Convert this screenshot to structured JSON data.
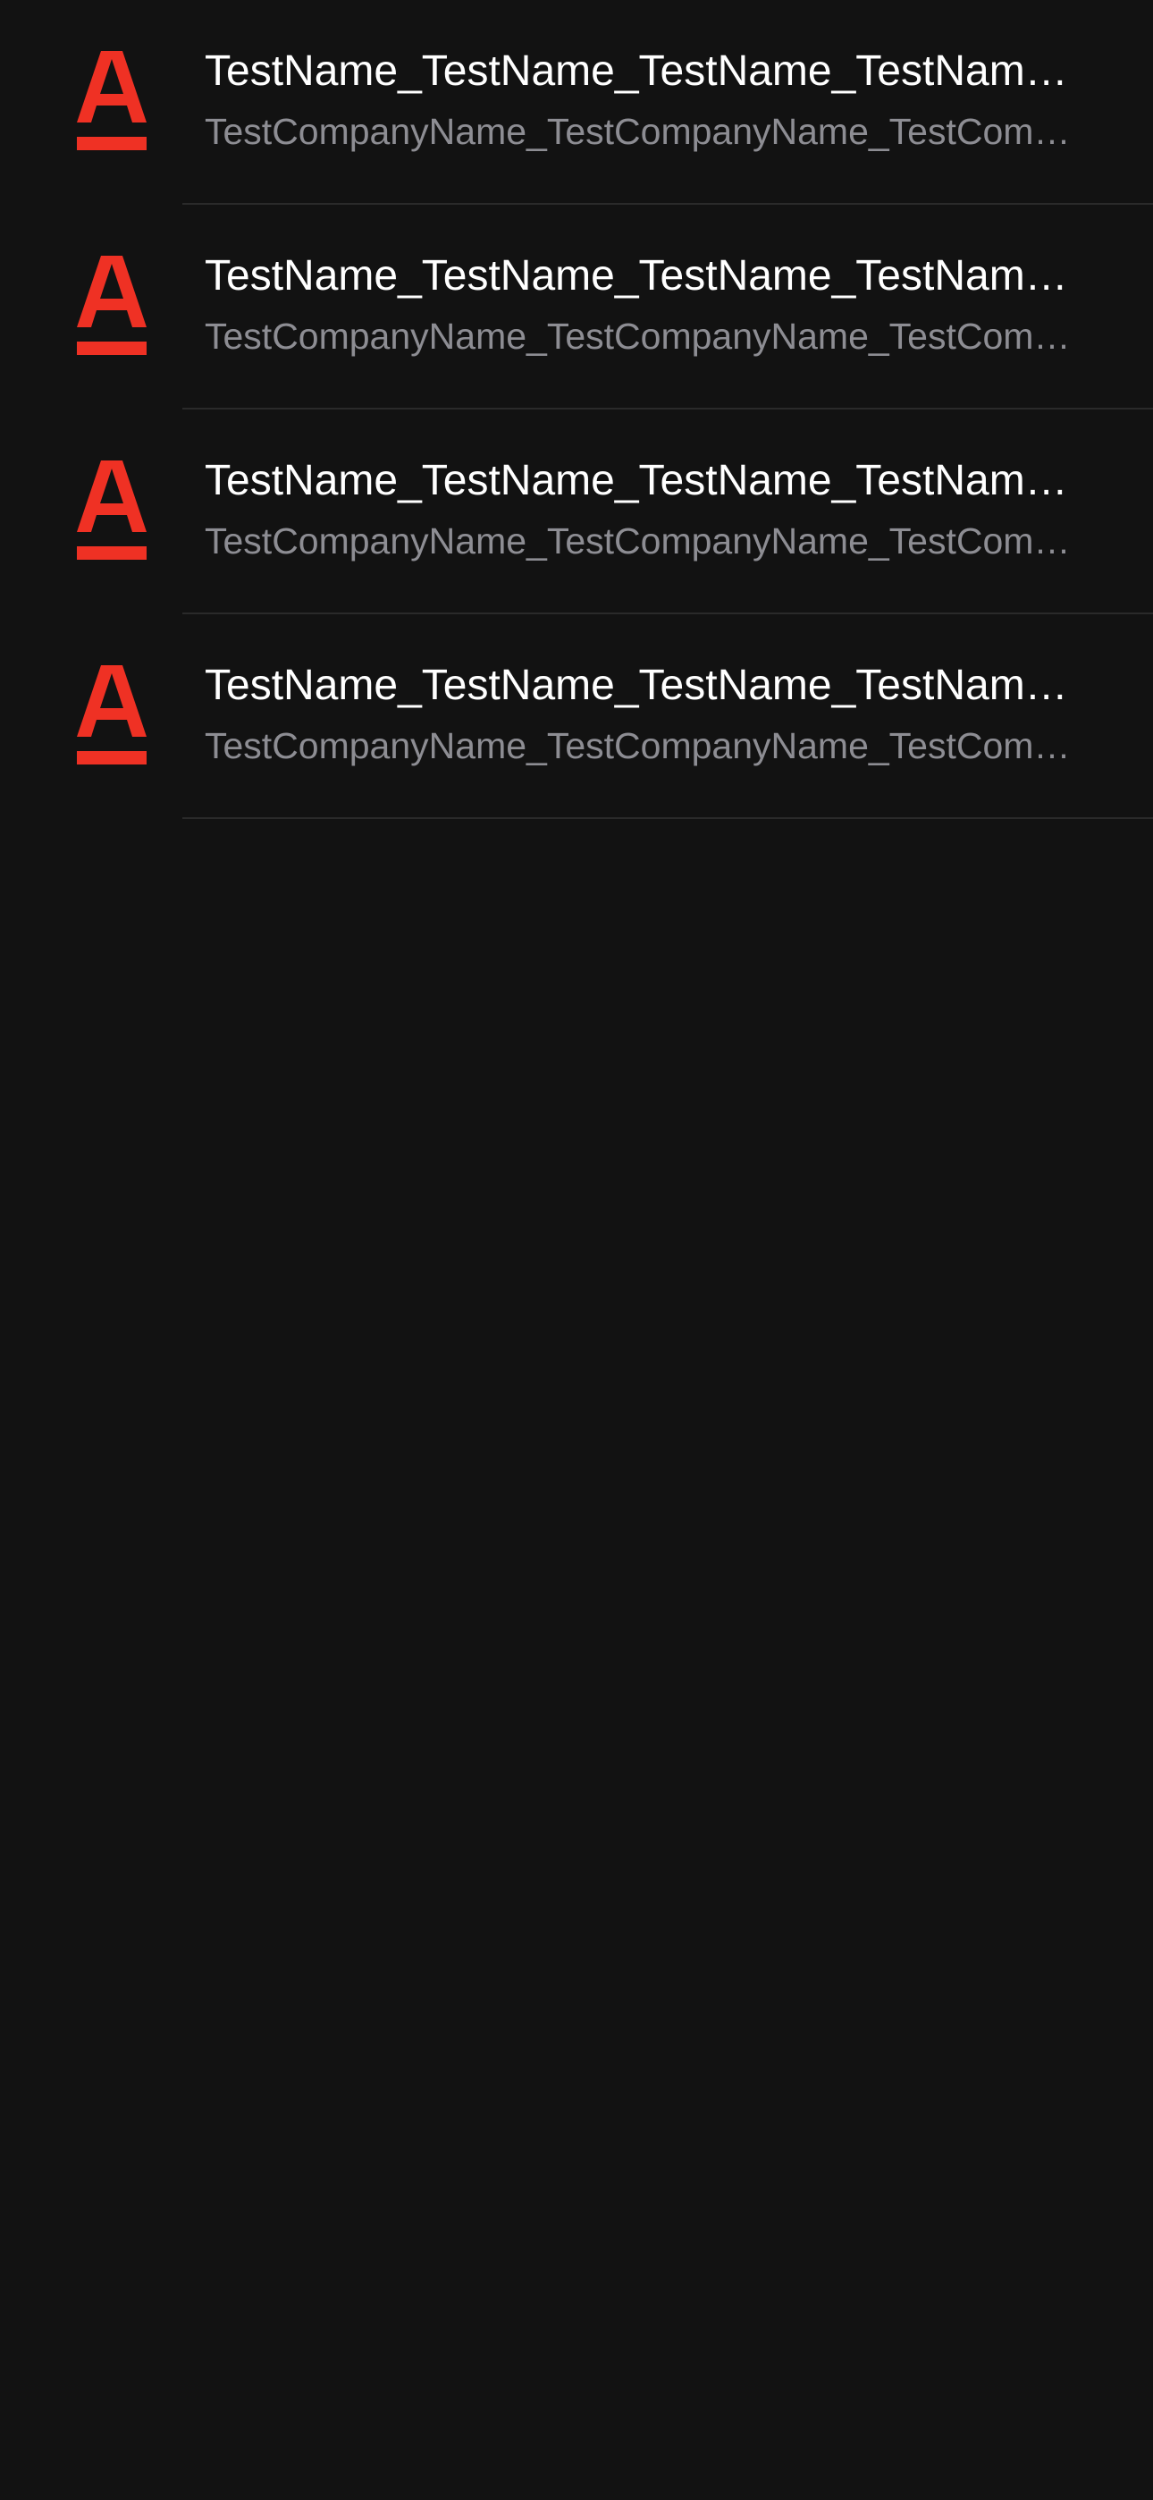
{
  "theme": {
    "background": "#121212",
    "accent": "#ef3124",
    "primary_text": "#ffffff",
    "secondary_text": "#8d8d93",
    "divider": "#2a2a2a"
  },
  "list": {
    "items": [
      {
        "icon": "alfa-bank-logo-icon",
        "name": "TestName_TestName_TestName_TestName_TestName",
        "company": "TestCompanyName_TestCompanyName_TestCompanyName"
      },
      {
        "icon": "alfa-bank-logo-icon",
        "name": "TestName_TestName_TestName_TestName_TestName",
        "company": "TestCompanyName_TestCompanyName_TestCompanyName"
      },
      {
        "icon": "alfa-bank-logo-icon",
        "name": "TestName_TestName_TestName_TestName_TestName",
        "company": "TestCompanyName_TestCompanyName_TestCompanyName"
      },
      {
        "icon": "alfa-bank-logo-icon",
        "name": "TestName_TestName_TestName_TestName_TestName",
        "company": "TestCompanyName_TestCompanyName_TestCompanyName"
      }
    ]
  }
}
